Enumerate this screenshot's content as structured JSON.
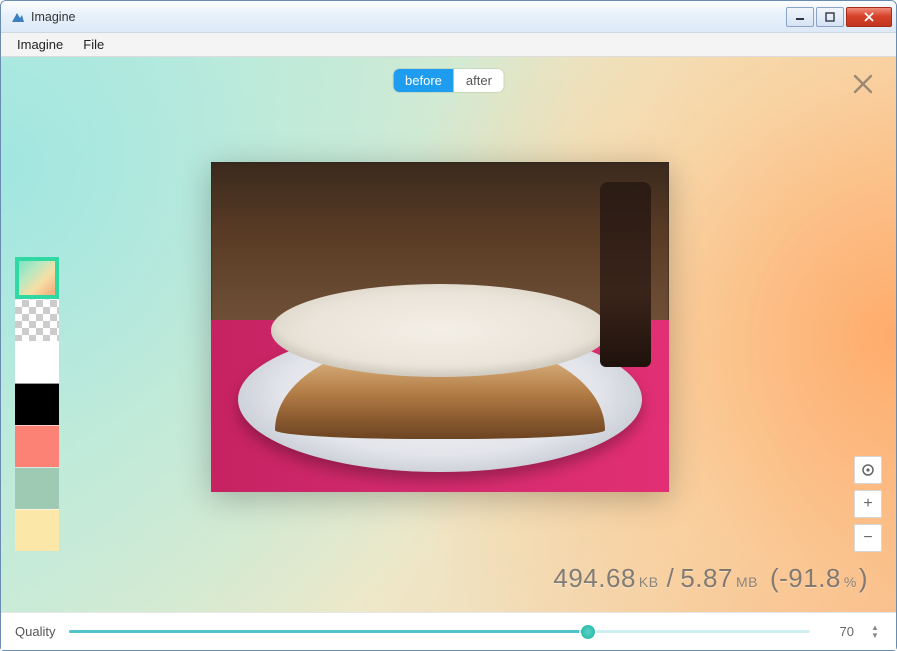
{
  "window": {
    "title": "Imagine"
  },
  "menu": {
    "items": [
      "Imagine",
      "File"
    ]
  },
  "toggle": {
    "before": "before",
    "after": "after",
    "active": "before"
  },
  "swatches": {
    "list": [
      "gradient",
      "checker",
      "white",
      "black",
      "salmon",
      "teal",
      "cream"
    ],
    "selected": "gradient"
  },
  "stats": {
    "before_size": "494.68",
    "before_unit": "KB",
    "after_size": "5.87",
    "after_unit": "MB",
    "change_pct": "-91.8"
  },
  "zoom": {
    "fit_icon": "crosshair-icon",
    "plus": "+",
    "minus": "−"
  },
  "quality": {
    "label": "Quality",
    "value": "70",
    "min": 0,
    "max": 100
  }
}
